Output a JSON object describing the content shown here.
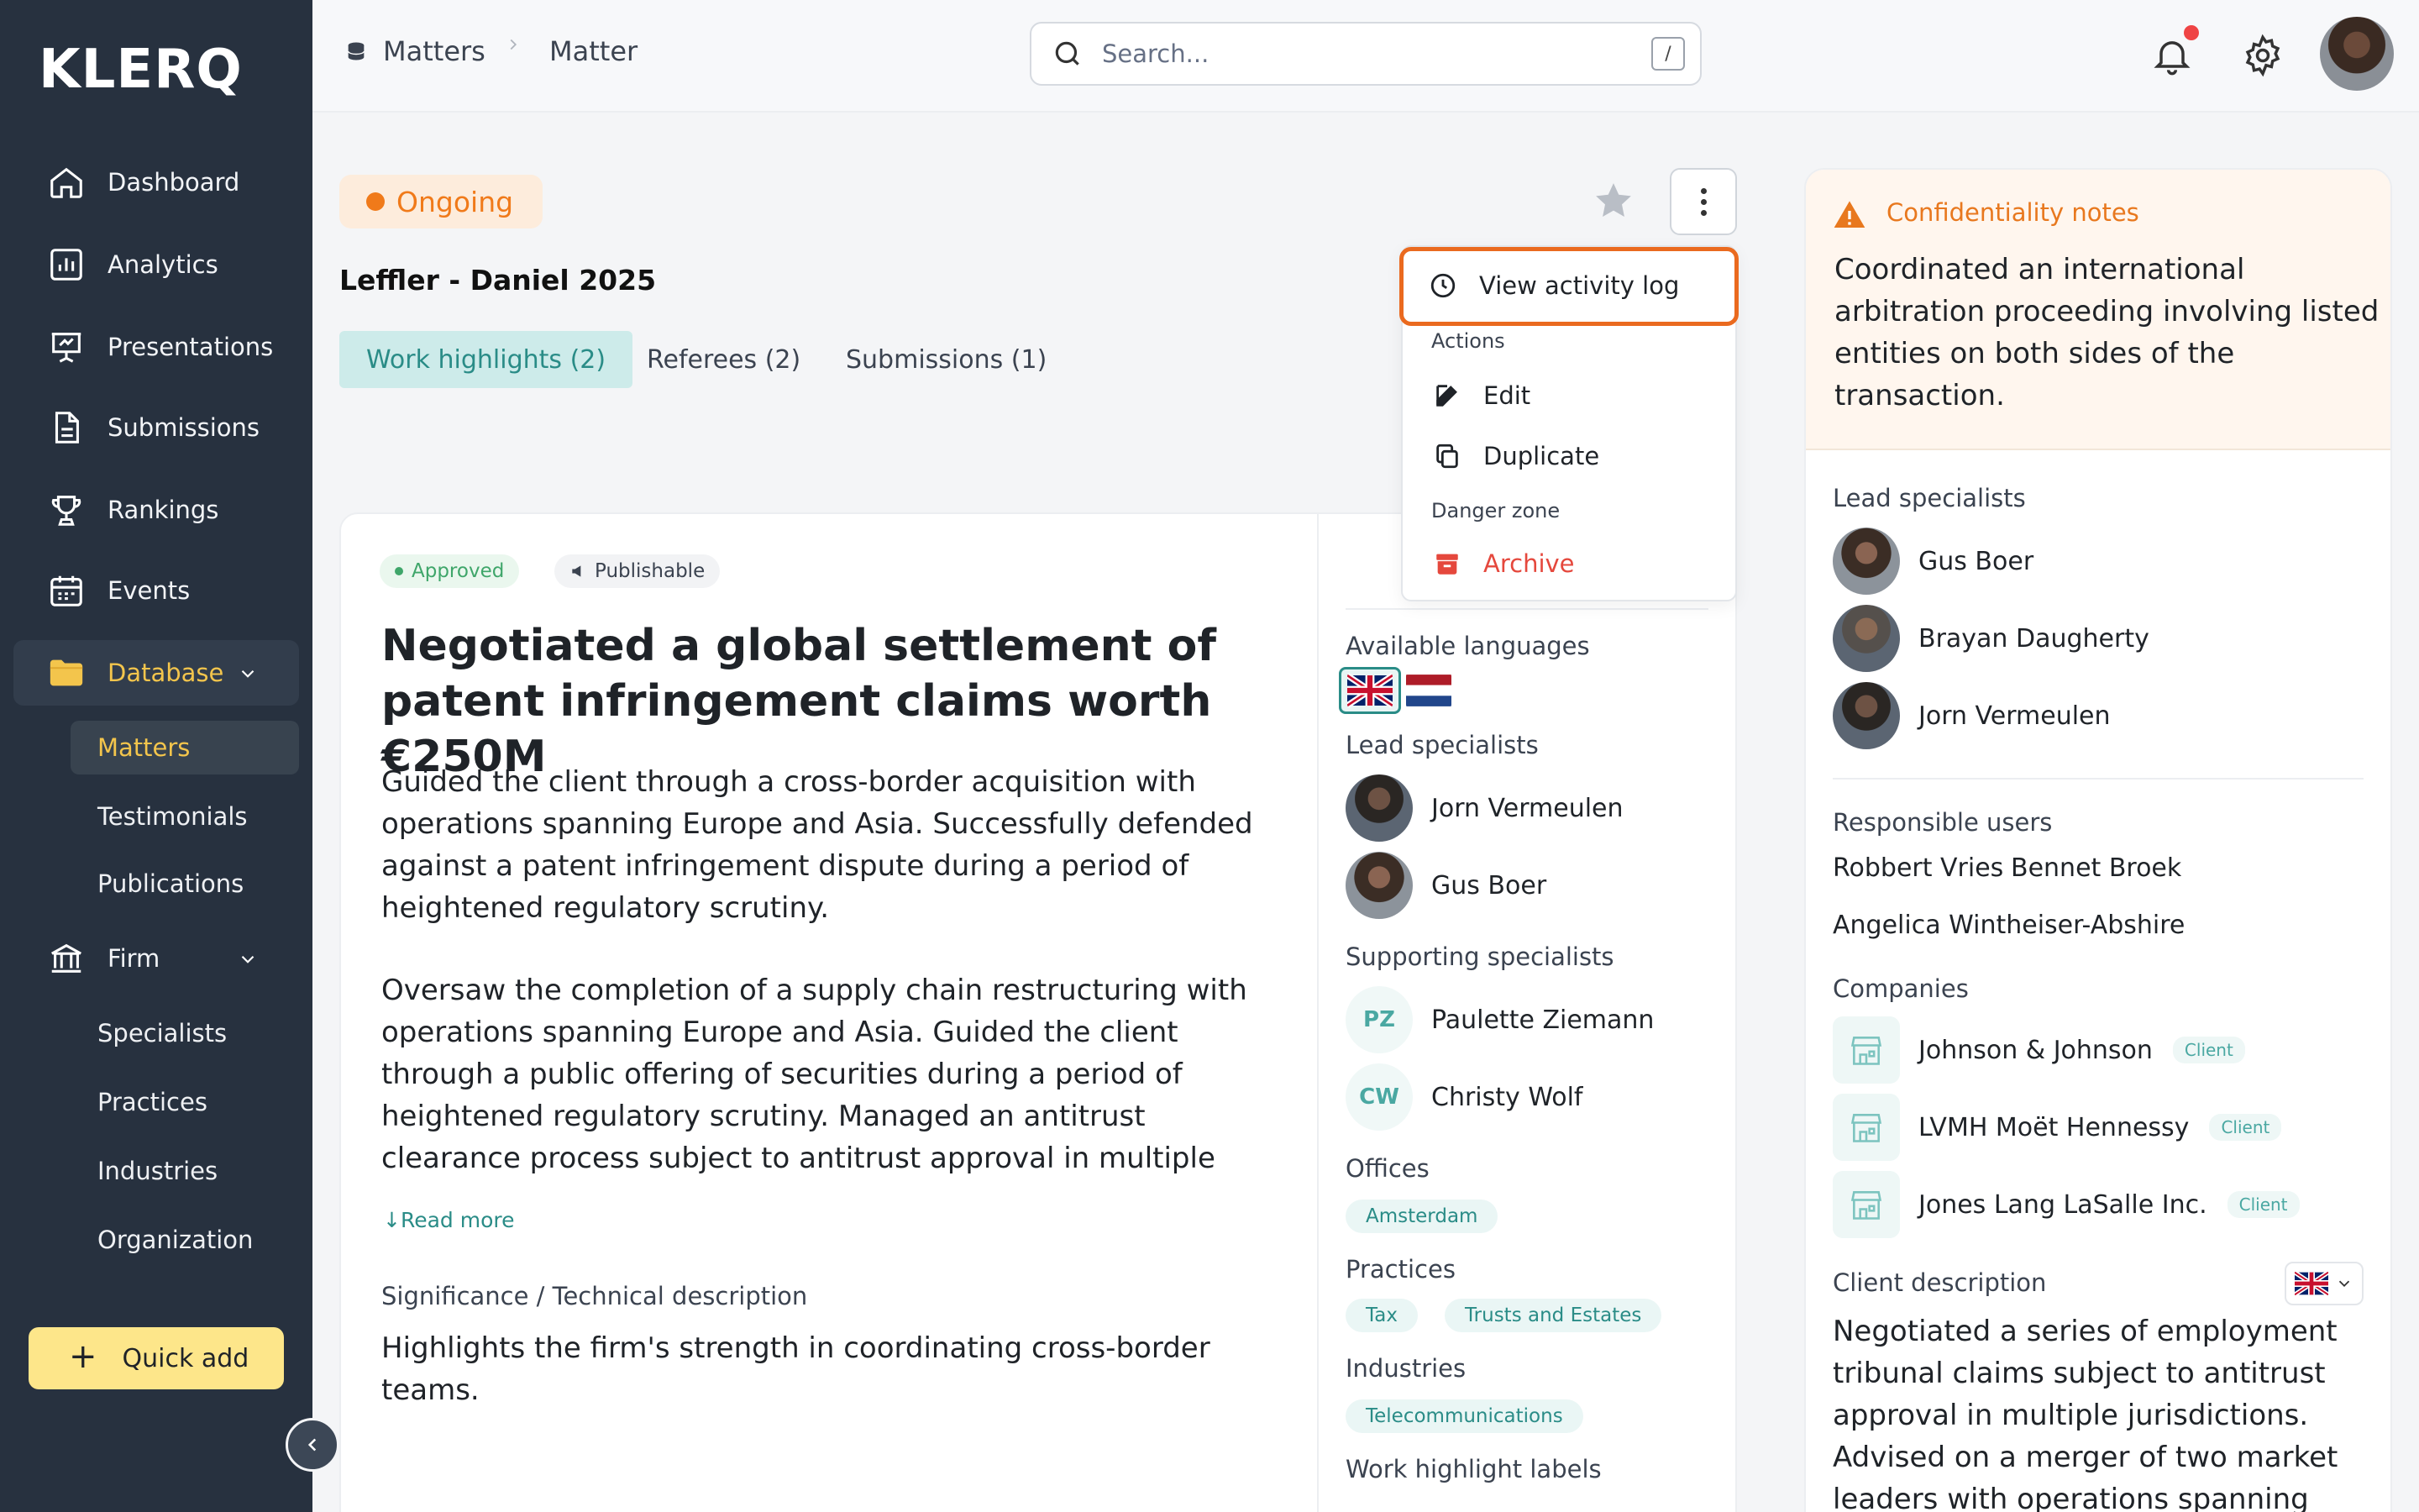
{
  "brand": {
    "logo": "KLERQ"
  },
  "sidebar": {
    "items": [
      {
        "label": "Dashboard",
        "icon": "home-icon"
      },
      {
        "label": "Analytics",
        "icon": "chart-icon"
      },
      {
        "label": "Presentations",
        "icon": "presentation-icon"
      },
      {
        "label": "Submissions",
        "icon": "document-icon"
      },
      {
        "label": "Rankings",
        "icon": "trophy-icon"
      },
      {
        "label": "Events",
        "icon": "calendar-icon"
      },
      {
        "label": "Database",
        "icon": "folder-icon"
      }
    ],
    "database_sub": [
      "Matters",
      "Testimonials",
      "Publications"
    ],
    "firm": {
      "label": "Firm",
      "icon": "bank-icon"
    },
    "firm_sub": [
      "Specialists",
      "Practices",
      "Industries",
      "Organization"
    ],
    "quick_add": "Quick add"
  },
  "header": {
    "breadcrumb": [
      "Matters",
      "Matter"
    ],
    "search_placeholder": "Search...",
    "shortcut": "/"
  },
  "matter": {
    "status": "Ongoing",
    "title": "Leffler - Daniel 2025",
    "tabs": [
      "Work highlights (2)",
      "Referees (2)",
      "Submissions (1)"
    ]
  },
  "menu": {
    "view_activity": "View activity log",
    "actions_heading": "Actions",
    "edit": "Edit",
    "duplicate": "Duplicate",
    "danger_heading": "Danger zone",
    "archive": "Archive"
  },
  "highlight": {
    "badge_approved": "Approved",
    "badge_publishable": "Publishable",
    "headline": "Negotiated a global settlement of patent infringement claims worth €250M",
    "para1": "Guided the client through a cross-border acquisition with operations spanning Europe and Asia. Successfully defended against a patent infringement dispute during a period of heightened regulatory scrutiny.",
    "para2": "Oversaw the completion of a supply chain restructuring with operations spanning Europe and Asia. Guided the client through a public offering of securities during a period of heightened regulatory scrutiny. Managed an antitrust clearance process subject to antitrust approval in multiple jurisdictions. Led the due",
    "read_more": "Read more",
    "significance_label": "Significance / Technical description",
    "significance_text": "Highlights the firm's strength in coordinating cross-border teams."
  },
  "details": {
    "languages_label": "Available languages",
    "lead_label": "Lead specialists",
    "lead": [
      "Jorn Vermeulen",
      "Gus Boer"
    ],
    "supporting_label": "Supporting specialists",
    "supporting": [
      {
        "initials": "PZ",
        "name": "Paulette Ziemann"
      },
      {
        "initials": "CW",
        "name": "Christy Wolf"
      }
    ],
    "offices_label": "Offices",
    "offices": [
      "Amsterdam"
    ],
    "practices_label": "Practices",
    "practices": [
      "Tax",
      "Trusts and Estates"
    ],
    "industries_label": "Industries",
    "industries": [
      "Telecommunications"
    ],
    "labels_label": "Work highlight labels"
  },
  "right": {
    "conf_title": "Confidentiality notes",
    "conf_text": "Coordinated an international arbitration proceeding involving listed entities on both sides of the transaction.",
    "lead_label": "Lead specialists",
    "lead": [
      "Gus Boer",
      "Brayan Daugherty",
      "Jorn Vermeulen"
    ],
    "responsible_label": "Responsible users",
    "responsible": [
      "Robbert Vries",
      "Bennet Broek",
      "Angelica Wintheiser-Abshire"
    ],
    "companies_label": "Companies",
    "companies": [
      {
        "name": "Johnson & Johnson",
        "tag": "Client"
      },
      {
        "name": "LVMH Moët Hennessy",
        "tag": "Client"
      },
      {
        "name": "Jones Lang LaSalle Inc.",
        "tag": "Client"
      }
    ],
    "client_desc_label": "Client description",
    "client_desc": "Negotiated a series of employment tribunal claims subject to antitrust approval in multiple jurisdictions. Advised on a merger of two market leaders with operations spanning"
  },
  "colors": {
    "accent": "#2a8c87",
    "warning": "#e8781e",
    "danger": "#e5483d",
    "sidebar": "#27313f"
  }
}
